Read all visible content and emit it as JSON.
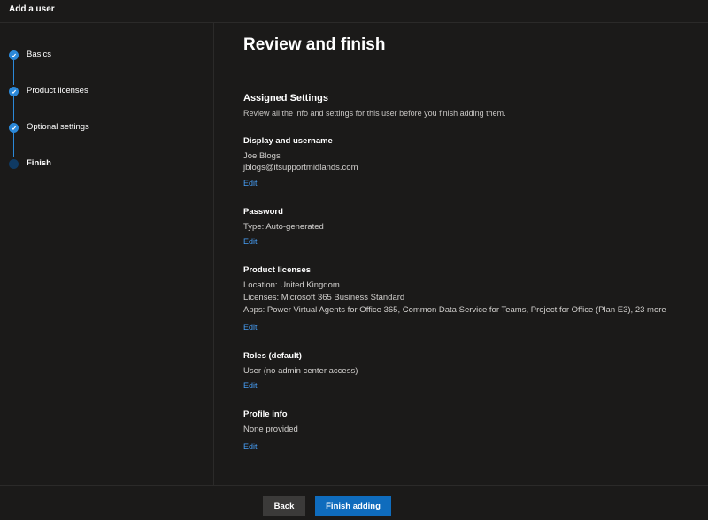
{
  "window": {
    "title": "Add a user"
  },
  "steps": [
    {
      "label": "Basics",
      "status": "done"
    },
    {
      "label": "Product licenses",
      "status": "done"
    },
    {
      "label": "Optional settings",
      "status": "done"
    },
    {
      "label": "Finish",
      "status": "current"
    }
  ],
  "main": {
    "title": "Review and finish",
    "assigned_heading": "Assigned Settings",
    "assigned_desc": "Review all the info and settings for this user before you finish adding them.",
    "display": {
      "title": "Display and username",
      "name": "Joe Blogs",
      "username": "jblogs@itsupportmidlands.com",
      "edit": "Edit"
    },
    "password": {
      "title": "Password",
      "type": "Type: Auto-generated",
      "edit": "Edit"
    },
    "licenses": {
      "title": "Product licenses",
      "location": "Location: United Kingdom",
      "licenses": "Licenses: Microsoft 365 Business Standard",
      "apps": "Apps: Power Virtual Agents for Office 365, Common Data Service for Teams, Project for Office (Plan E3), 23 more",
      "edit": "Edit"
    },
    "roles": {
      "title": "Roles (default)",
      "value": "User (no admin center access)",
      "edit": "Edit"
    },
    "profile": {
      "title": "Profile info",
      "value": "None provided",
      "edit": "Edit"
    }
  },
  "footer": {
    "back_label": "Back",
    "finish_label": "Finish adding"
  },
  "colors": {
    "background": "#1b1a19",
    "accent": "#2b88d8",
    "link": "#479ef5",
    "primary_button": "#0f6cbd"
  }
}
